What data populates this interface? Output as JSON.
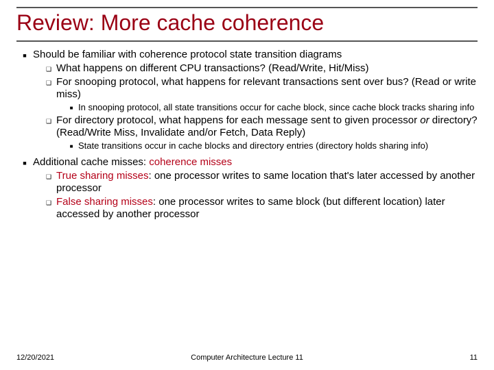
{
  "title": "Review: More cache coherence",
  "bullets": {
    "a": "Should be familiar with coherence protocol state transition diagrams",
    "a1": "What happens on different CPU transactions?  (Read/Write, Hit/Miss)",
    "a2": "For snooping protocol, what happens for relevant transactions sent over bus? (Read or write miss)",
    "a2i": "In snooping protocol, all state transitions occur for cache block, since cache block tracks sharing info",
    "a3_pre": "For directory protocol, what happens for each message sent to given processor ",
    "a3_or": "or",
    "a3_post": " directory? (Read/Write Miss, Invalidate and/or Fetch, Data Reply)",
    "a3i": "State transitions occur in cache blocks and directory entries (directory holds sharing info)",
    "b_pre": "Additional cache misses: ",
    "b_red": "coherence misses",
    "b1_red": "True sharing misses",
    "b1_post": ": one processor writes to same location that's later accessed by another processor",
    "b2_red": "False sharing misses",
    "b2_post": ": one processor writes to same block (but different location) later accessed by another processor"
  },
  "footer": {
    "date": "12/20/2021",
    "center": "Computer Architecture Lecture 11",
    "page": "11"
  }
}
